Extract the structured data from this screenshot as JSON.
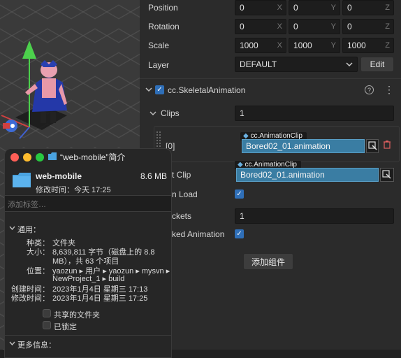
{
  "inspector": {
    "position": {
      "label": "Position",
      "x": "0",
      "y": "0",
      "z": "0"
    },
    "rotation": {
      "label": "Rotation",
      "x": "0",
      "y": "0",
      "z": "0"
    },
    "scale": {
      "label": "Scale",
      "x": "1000",
      "y": "1000",
      "z": "1000"
    },
    "axes": {
      "x": "X",
      "y": "Y",
      "z": "Z"
    },
    "layer": {
      "label": "Layer",
      "value": "DEFAULT",
      "edit_label": "Edit"
    },
    "component": {
      "title": "cc.SkeletalAnimation"
    },
    "clips": {
      "label": "Clips",
      "count": "1",
      "item_index": "[0]",
      "item_type": "cc.AnimationClip",
      "item_value": "Bored02_01.animation"
    },
    "default_clip": {
      "label": "t Clip",
      "type": "cc.AnimationClip",
      "value": "Bored02_01.animation"
    },
    "play_on_load": {
      "label": "n Load"
    },
    "sockets": {
      "label": "ckets",
      "value": "1"
    },
    "baked": {
      "label": "ked Animation"
    },
    "add_component_label": "添加组件"
  },
  "info_window": {
    "title": "“web-mobile”简介",
    "name": "web-mobile",
    "size": "8.6 MB",
    "modified_line": "修改时间：今天 17:25",
    "tags_placeholder": "添加标签…",
    "general_label": "通用：",
    "kind_label": "种类：",
    "kind_value": "文件夹",
    "size_label": "大小：",
    "size_value_1": "8,639,811 字节（磁盘上的 8.8",
    "size_value_2": "MB），共 63 个项目",
    "where_label": "位置：",
    "where_value_1": "yaozun ▸ 用户 ▸ yaozun ▸ mysvn ▸",
    "where_value_2": "NewProject_1 ▸ build",
    "created_label": "创建时间：",
    "created_value": "2023年1月4日 星期三 17:13",
    "modified_label": "修改时间：",
    "modified_value": "2023年1月4日 星期三 17:25",
    "shared_label": "共享的文件夹",
    "locked_label": "已锁定",
    "more_info_label": "更多信息："
  },
  "colors": {
    "accent": "#2f6fb8",
    "asset_field": "#3a7da3",
    "folder": "#4aa3e0"
  }
}
